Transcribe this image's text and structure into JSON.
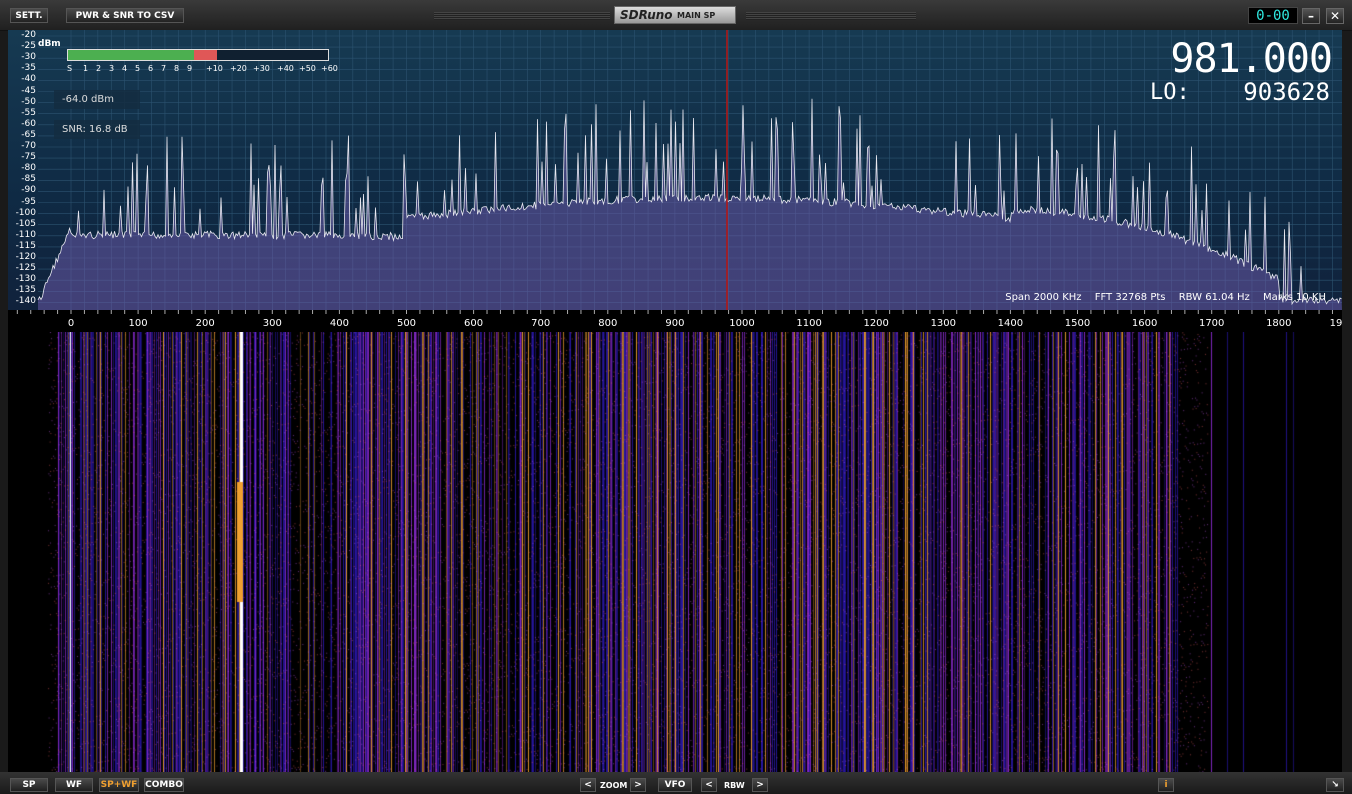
{
  "toolbar": {
    "settings_label": "SETT.",
    "csv_label": "PWR & SNR TO CSV",
    "app_logo": "SDRuno",
    "window_name": "MAIN SP",
    "clock": "0-00",
    "minimize_label": "–",
    "close_label": "✕"
  },
  "spectrum": {
    "unit": "dBm",
    "y_ticks": [
      "-20",
      "-25",
      "-30",
      "-35",
      "-40",
      "-45",
      "-50",
      "-55",
      "-60",
      "-65",
      "-70",
      "-75",
      "-80",
      "-85",
      "-90",
      "-95",
      "-100",
      "-105",
      "-110",
      "-115",
      "-120",
      "-125",
      "-130",
      "-135",
      "-140"
    ],
    "power_readout": "-64.0 dBm",
    "snr_readout": "SNR: 16.8 dB",
    "frequency": "981.000",
    "lo_label": "LO:",
    "lo_value": "903628",
    "span": "Span 2000 KHz",
    "fft": "FFT 32768 Pts",
    "rbw": "RBW 61.04 Hz",
    "marks": "Marks 10 KH"
  },
  "smeter": {
    "ticks": [
      "S",
      "1",
      "2",
      "3",
      "4",
      "5",
      "6",
      "7",
      "8",
      "9",
      "+10",
      "+20",
      "+30",
      "+40",
      "+50",
      "+60"
    ],
    "s_fraction": 0.485,
    "red_fraction": 0.09
  },
  "freq_axis": {
    "ticks": [
      "0",
      "100",
      "200",
      "300",
      "400",
      "500",
      "600",
      "700",
      "800",
      "900",
      "1000",
      "1100",
      "1200",
      "1300",
      "1400",
      "1500",
      "1600",
      "1700",
      "1800",
      "19"
    ]
  },
  "bottom": {
    "sp_label": "SP",
    "wf_label": "WF",
    "spwf_label": "SP+WF",
    "combo_label": "COMBO",
    "zoom_label": "ZOOM",
    "vfo_label": "VFO",
    "rbw_label": "RBW",
    "prev_label": "<",
    "next_label": ">",
    "info_label": "i",
    "resize_label": "↘"
  },
  "colors": {
    "accent": "#f0a030",
    "spectrum_fill": "#6a5aa8",
    "marker": "#b01818",
    "clock": "#2fe8e0"
  }
}
